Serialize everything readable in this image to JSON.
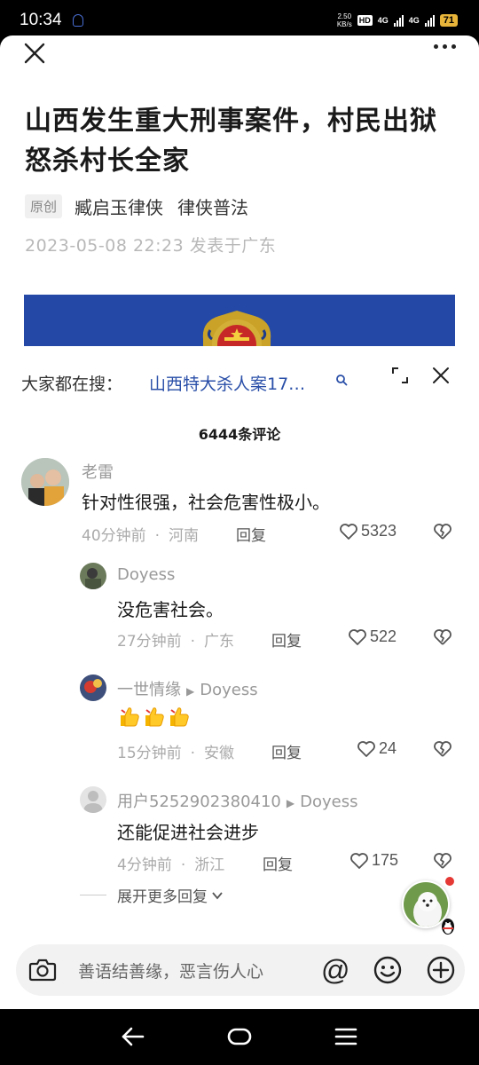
{
  "status": {
    "time": "10:34",
    "speed_top": "2.50",
    "speed_unit": "KB/s",
    "hd": "HD",
    "net1": "4G",
    "net2": "4G",
    "battery": "71"
  },
  "article": {
    "title": "山西发生重大刑事案件，村民出狱怒杀村长全家",
    "tag": "原创",
    "author": "臧启玉律侠",
    "source": "律侠普法",
    "published": "2023-05-08 22:23  发表于广东"
  },
  "panel": {
    "search_hint": "大家都在搜：",
    "search_link": "山西特大杀人案17…",
    "comment_count": "6444条评论"
  },
  "comments": [
    {
      "name": "老雷",
      "text": "针对性很强，社会危害性极小。",
      "time": "40分钟前",
      "region": "河南",
      "reply": "回复",
      "likes": "5323"
    },
    {
      "name": "Doyess",
      "text": "没危害社会。",
      "time": "27分钟前",
      "region": "广东",
      "reply": "回复",
      "likes": "522"
    },
    {
      "name": "一世情缘",
      "reply_to": "Doyess",
      "text": "",
      "emoji": [
        "thumbs-up",
        "thumbs-up",
        "thumbs-up"
      ],
      "time": "15分钟前",
      "region": "安徽",
      "reply": "回复",
      "likes": "24"
    },
    {
      "name": "用户5252902380410",
      "reply_to": "Doyess",
      "text": "还能促进社会进步",
      "time": "4分钟前",
      "region": "浙江",
      "reply": "回复",
      "likes": "175"
    }
  ],
  "expand_more": "展开更多回复",
  "input": {
    "placeholder": "善语结善缘，恶言伤人心",
    "at": "@"
  },
  "colors": {
    "link": "#2a4fa8",
    "image_bg": "#2348a6",
    "battery": "#e8b53a"
  }
}
